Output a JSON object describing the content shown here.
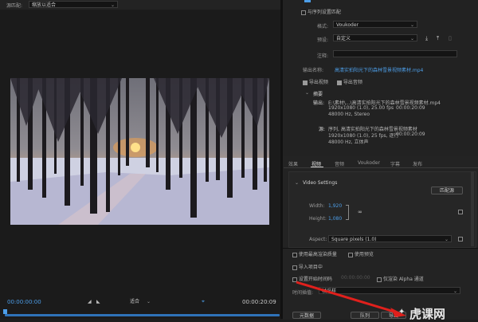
{
  "source": {
    "label": "源匹配:",
    "value": "缩放以适合"
  },
  "player": {
    "timecode_current": "00:00:00:00",
    "timecode_total": "00:00:20:09",
    "fit_label": "适合"
  },
  "export": {
    "match_sequence_label": "与序列设置匹配",
    "format_label": "格式:",
    "format_value": "Voukoder",
    "preset_label": "预设:",
    "preset_value": "自定义",
    "comments_label": "注释:",
    "output_name_label": "输出名称:",
    "output_name_value": "高清实拍阳光下的森林雪景视频素材.mp4",
    "export_video_label": "导出视频",
    "export_audio_label": "导出音频",
    "summary_title": "摘要",
    "output_label": "输出:",
    "output_path": "E:\\素材\\...\\高清实拍阳光下的森林雪景视频素材.mp4",
    "output_line2": "1920x1080 (1.0), 25.00 fps",
    "output_line2_tail": "00:00:20:09",
    "output_line3": "48000 Hz, Stereo",
    "source_label": "源:",
    "source_line1": "序列, 高清实拍阳光下的森林雪景视频素材",
    "source_line2": "1920x1080 (1.0), 25 fps, 逐行",
    "source_line2_tail": "00:00:20:09",
    "source_line3": "48000 Hz, 立体声"
  },
  "tabs": [
    "效果",
    "视频",
    "音频",
    "Voukoder",
    "字幕",
    "发布"
  ],
  "video_settings": {
    "title": "Video Settings",
    "match_source_button": "匹配源",
    "width_label": "Width:",
    "width_value": "1,920",
    "height_label": "Height:",
    "height_value": "1,080",
    "aspect_label": "Aspect:",
    "aspect_value": "Square pixels (1.0)"
  },
  "options": {
    "max_render_quality": "使用最高渲染质量",
    "use_previews": "使用预览",
    "import_into_project": "导入项目中",
    "set_start_timecode": "设置开始时间码",
    "start_timecode_value": "00:00:00:00",
    "render_alpha_only": "仅渲染 Alpha 通道",
    "time_interpolation_label": "时间插值:",
    "time_interpolation_value": "帧采样"
  },
  "buttons": {
    "metadata": "元数据",
    "queue": "队列",
    "export": "导出"
  },
  "watermark": "虎课网"
}
